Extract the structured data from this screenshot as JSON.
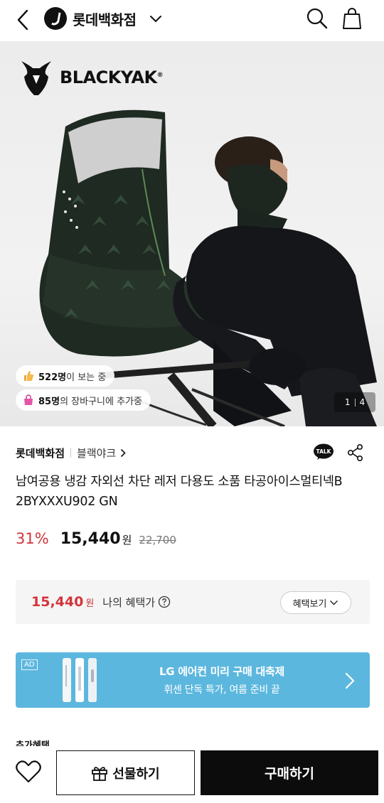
{
  "header": {
    "store_name": "롯데백화점",
    "icons": {
      "back": "chevron-left-icon",
      "logo": "lotte-logo-icon",
      "dropdown": "chevron-down-icon",
      "search": "search-icon",
      "cart": "shopping-bag-icon"
    }
  },
  "hero": {
    "brand_logo_text": "BLACKYAK",
    "brand_logo_mark": "®",
    "viewers_count": "522명",
    "viewers_text": "이 보는 중",
    "cart_count": "85명",
    "cart_text": "의 장바구니에 추가중",
    "image_index": "1",
    "image_total": "4"
  },
  "seller": {
    "name": "롯데백화점",
    "brand": "블랙야크",
    "talk_label": "TALK"
  },
  "product": {
    "title": "남여공용 냉감 자외선 차단 레저 다용도 소품 타공아이스멀티넥B 2BYXXXU902 GN",
    "discount": "31%",
    "price": "15,440",
    "currency": "원",
    "original_price": "22,700"
  },
  "benefit": {
    "price": "15,440",
    "currency": "원",
    "label": "나의 혜택가",
    "button_label": "혜택보기"
  },
  "ad": {
    "tag": "AD",
    "title": "LG 에어컨 미리 구매 대축제",
    "subtitle": "휘센 단독 특가, 여름 준비 끝"
  },
  "extra_section_label": "추가혜택",
  "bottom_bar": {
    "gift_label": "선물하기",
    "buy_label": "구매하기"
  },
  "colors": {
    "accent_red": "#d3343a",
    "ad_blue": "#5cb7de",
    "buy_black": "#0c0c0c"
  }
}
